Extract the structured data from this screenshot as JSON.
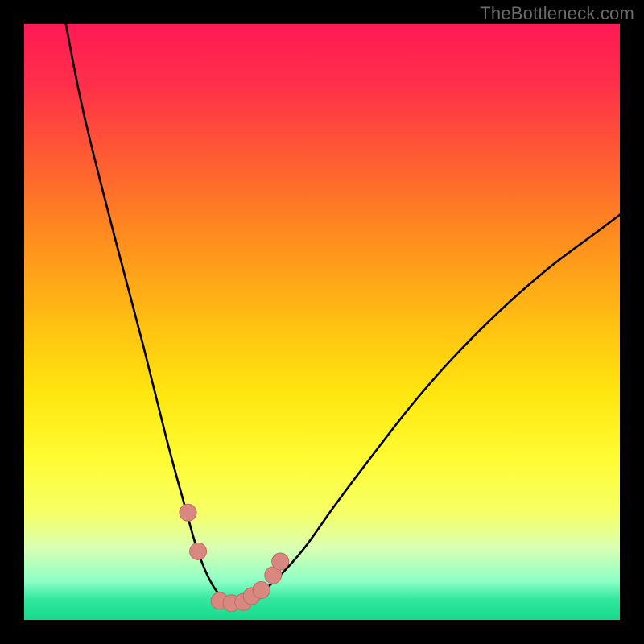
{
  "watermark": "TheBottleneck.com",
  "colors": {
    "frame": "#000000",
    "watermark": "#6b6b6b",
    "curve": "#000000",
    "marker_fill": "#d98880",
    "marker_stroke": "#c06a63",
    "gradient_stops": [
      {
        "offset": 0.0,
        "color": "#ff1a55"
      },
      {
        "offset": 0.1,
        "color": "#ff2f4a"
      },
      {
        "offset": 0.22,
        "color": "#ff5a33"
      },
      {
        "offset": 0.35,
        "color": "#ff8a1f"
      },
      {
        "offset": 0.5,
        "color": "#ffbf12"
      },
      {
        "offset": 0.62,
        "color": "#ffe60f"
      },
      {
        "offset": 0.73,
        "color": "#fffc33"
      },
      {
        "offset": 0.82,
        "color": "#f6ff66"
      },
      {
        "offset": 0.88,
        "color": "#d9ffb3"
      },
      {
        "offset": 0.935,
        "color": "#8cffc6"
      },
      {
        "offset": 0.965,
        "color": "#33e8a0"
      },
      {
        "offset": 1.0,
        "color": "#17d98c"
      }
    ]
  },
  "chart_data": {
    "type": "line",
    "title": "",
    "xlabel": "",
    "ylabel": "",
    "xlim": [
      0,
      100
    ],
    "ylim": [
      0,
      100
    ],
    "series": [
      {
        "name": "bottleneck-curve",
        "x": [
          7,
          10,
          15,
          20,
          24,
          27,
          29,
          31,
          33,
          35,
          37,
          39,
          42.5,
          47,
          52,
          58,
          65,
          72,
          80,
          88,
          96,
          100
        ],
        "y": [
          100,
          85,
          65,
          46,
          30,
          19,
          12,
          7,
          4,
          3,
          3,
          4,
          7,
          12,
          19,
          27,
          36,
          44,
          52,
          59,
          65,
          68
        ]
      }
    ],
    "markers": {
      "name": "highlight-points",
      "x": [
        27.5,
        29.2,
        32.8,
        34.8,
        36.8,
        38.2,
        39.8,
        41.8,
        43.0
      ],
      "y": [
        18.0,
        11.5,
        3.2,
        2.8,
        3.0,
        4.0,
        5.0,
        7.5,
        9.8
      ]
    }
  }
}
